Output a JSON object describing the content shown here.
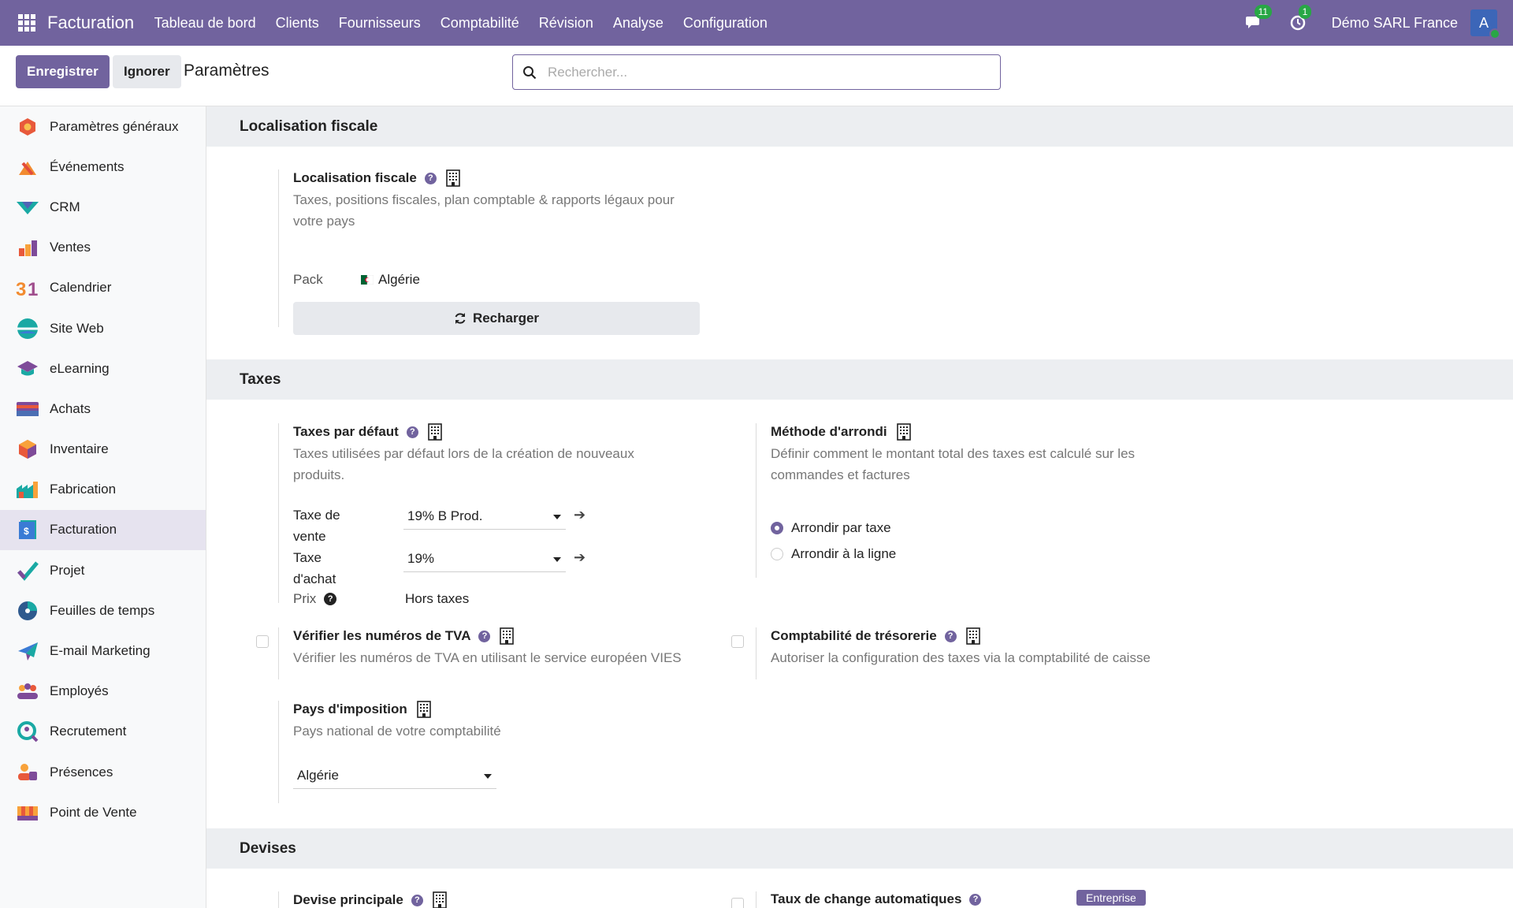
{
  "navbar": {
    "app_name": "Facturation",
    "menu": [
      "Tableau de bord",
      "Clients",
      "Fournisseurs",
      "Comptabilité",
      "Révision",
      "Analyse",
      "Configuration"
    ],
    "messages_count": "11",
    "activities_count": "1",
    "company": "Démo SARL France",
    "avatar_letter": "A"
  },
  "control": {
    "save_label": "Enregistrer",
    "discard_label": "Ignorer",
    "breadcrumb": "Paramètres",
    "search_placeholder": "Rechercher..."
  },
  "sidebar": {
    "items": [
      {
        "label": "Paramètres généraux",
        "icon": "settings-app-icon"
      },
      {
        "label": "Événements",
        "icon": "events-app-icon"
      },
      {
        "label": "CRM",
        "icon": "crm-app-icon"
      },
      {
        "label": "Ventes",
        "icon": "sales-app-icon"
      },
      {
        "label": "Calendrier",
        "icon": "calendar-app-icon"
      },
      {
        "label": "Site Web",
        "icon": "website-app-icon"
      },
      {
        "label": "eLearning",
        "icon": "elearning-app-icon"
      },
      {
        "label": "Achats",
        "icon": "purchase-app-icon"
      },
      {
        "label": "Inventaire",
        "icon": "inventory-app-icon"
      },
      {
        "label": "Fabrication",
        "icon": "manufacturing-app-icon"
      },
      {
        "label": "Facturation",
        "icon": "invoicing-app-icon"
      },
      {
        "label": "Projet",
        "icon": "project-app-icon"
      },
      {
        "label": "Feuilles de temps",
        "icon": "timesheet-app-icon"
      },
      {
        "label": "E-mail Marketing",
        "icon": "email-marketing-app-icon"
      },
      {
        "label": "Employés",
        "icon": "employees-app-icon"
      },
      {
        "label": "Recrutement",
        "icon": "recruitment-app-icon"
      },
      {
        "label": "Présences",
        "icon": "attendance-app-icon"
      },
      {
        "label": "Point de Vente",
        "icon": "pos-app-icon"
      }
    ],
    "active_index": 10
  },
  "sections": {
    "fiscal": {
      "header": "Localisation fiscale",
      "title": "Localisation fiscale",
      "desc_line1": "Taxes, positions fiscales, plan comptable & rapports légaux pour",
      "desc_line2": "votre pays",
      "pack_label": "Pack",
      "pack_value": "Algérie",
      "reload_label": "Recharger"
    },
    "taxes": {
      "header": "Taxes",
      "default_title": "Taxes par défaut",
      "default_desc_line1": "Taxes utilisées par défaut lors de la création de nouveaux",
      "default_desc_line2": "produits.",
      "sale_label_1": "Taxe de",
      "sale_label_2": "vente",
      "sale_value": "19% B Prod.",
      "purchase_label_1": "Taxe",
      "purchase_label_2": "d'achat",
      "purchase_value": "19%",
      "price_label": "Prix",
      "price_value": "Hors taxes",
      "rounding_title": "Méthode d'arrondi",
      "rounding_desc_line1": "Définir comment le montant total des taxes est calculé sur les",
      "rounding_desc_line2": "commandes et factures",
      "rounding_options": [
        "Arrondir par taxe",
        "Arrondir à la ligne"
      ],
      "rounding_selected": 0,
      "vat_title": "Vérifier les numéros de TVA",
      "vat_desc": "Vérifier les numéros de TVA en utilisant le service européen VIES",
      "cash_title": "Comptabilité de trésorerie",
      "cash_desc": "Autoriser la configuration des taxes via la comptabilité de caisse",
      "country_title": "Pays d'imposition",
      "country_desc": "Pays national de votre comptabilité",
      "country_value": "Algérie"
    },
    "currencies": {
      "header": "Devises",
      "main_title": "Devise principale",
      "auto_title": "Taux de change automatiques",
      "enterprise_badge": "Entreprise"
    }
  }
}
